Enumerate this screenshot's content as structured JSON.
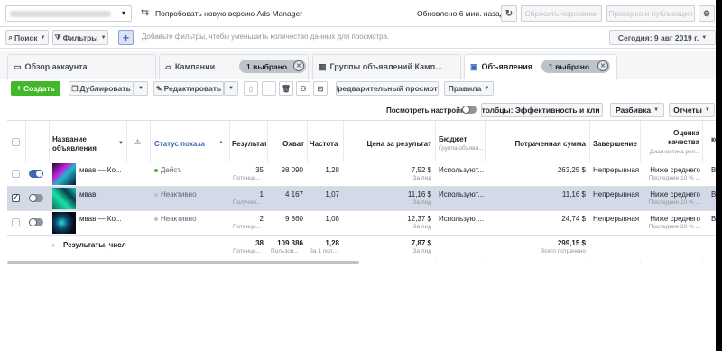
{
  "top": {
    "account_name": "",
    "try_new": "Попробовать новую версию Ads Manager",
    "updated": "Обновлено 6 мин. назад",
    "discard_drafts": "Сбросить черновики",
    "review_publish": "Проверка и публикация"
  },
  "filters": {
    "search": "Поиск",
    "filters": "Фильтры",
    "add_placeholder": "Добавьте фильтры, чтобы уменьшить количество данных для просмотра.",
    "date": "Сегодня: 9 авг 2019 г."
  },
  "tabs": {
    "overview": "Обзор аккаунта",
    "campaigns": "Кампании",
    "campaigns_selected": "1 выбрано",
    "adsets": "Группы объявлений Камп...",
    "ads": "Объявления",
    "ads_selected": "1 выбрано"
  },
  "toolbar": {
    "create": "Создать",
    "duplicate": "Дублировать",
    "edit": "Редактировать",
    "preview": "Предварительный просмотр",
    "rules": "Правила",
    "view_settings": "Посмотреть настройки",
    "columns": "Столбцы: Эффективность и кли",
    "breakdown": "Разбивка",
    "reports": "Отчеты"
  },
  "table": {
    "headers": {
      "name": "Название объявления",
      "status": "Статус показа",
      "results": "Результат",
      "reach": "Охват",
      "frequency": "Частота",
      "cpr": "Цена за результат",
      "budget": "Бюджет",
      "budget_sub": "Группа объявл...",
      "spent": "Потраченная сумма",
      "ends": "Завершение",
      "quality": "Оценка качества",
      "quality_sub": "Диагностика рел...",
      "extra": "ко"
    },
    "rows": [
      {
        "name": "мвав — Ко...",
        "status": "Дейст.",
        "status_color": "#42b72a",
        "results": "35",
        "results_sub": "Потенци...",
        "reach": "98 090",
        "frequency": "1,28",
        "cpr": "7,52 $",
        "cpr_sub": "За лид",
        "budget": "Используют...",
        "spent": "263,25 $",
        "ends": "Непрерывная",
        "quality": "Ниже среднего",
        "quality_sub": "Последние 10 % ...",
        "extra": "Вь"
      },
      {
        "name": "мвав",
        "status": "Неактивно",
        "status_color": "#bec3c9",
        "results": "1",
        "results_sub": "Получен...",
        "reach": "4 167",
        "frequency": "1,07",
        "cpr": "11,16 $",
        "cpr_sub": "За лид",
        "budget": "Используют...",
        "spent": "11,16 $",
        "ends": "Непрерывная",
        "quality": "Ниже среднего",
        "quality_sub": "Последние 10 % ...",
        "extra": "Вь"
      },
      {
        "name": "мвав — Ко...",
        "status": "Неактивно",
        "status_color": "#bec3c9",
        "results": "2",
        "results_sub": "Потенци...",
        "reach": "9 860",
        "frequency": "1,08",
        "cpr": "12,37 $",
        "cpr_sub": "За лид",
        "budget": "Используют...",
        "spent": "24,74 $",
        "ends": "Непрерывная",
        "quality": "Ниже среднего",
        "quality_sub": "Последние 20 % ...",
        "extra": "Вь"
      }
    ],
    "totals": {
      "label": "Результаты, числ",
      "results": "38",
      "results_sub": "Потенци...",
      "reach": "109 386",
      "reach_sub": "Пользов...",
      "frequency": "1,28",
      "frequency_sub": "За 1 пол...",
      "cpr": "7,87 $",
      "cpr_sub": "За лид",
      "spent": "299,15 $",
      "spent_sub": "Всего потрачено"
    }
  },
  "colors": {
    "accent": "#4267b2",
    "create_green": "#42b72a",
    "selected_row": "#d3d9e6"
  }
}
